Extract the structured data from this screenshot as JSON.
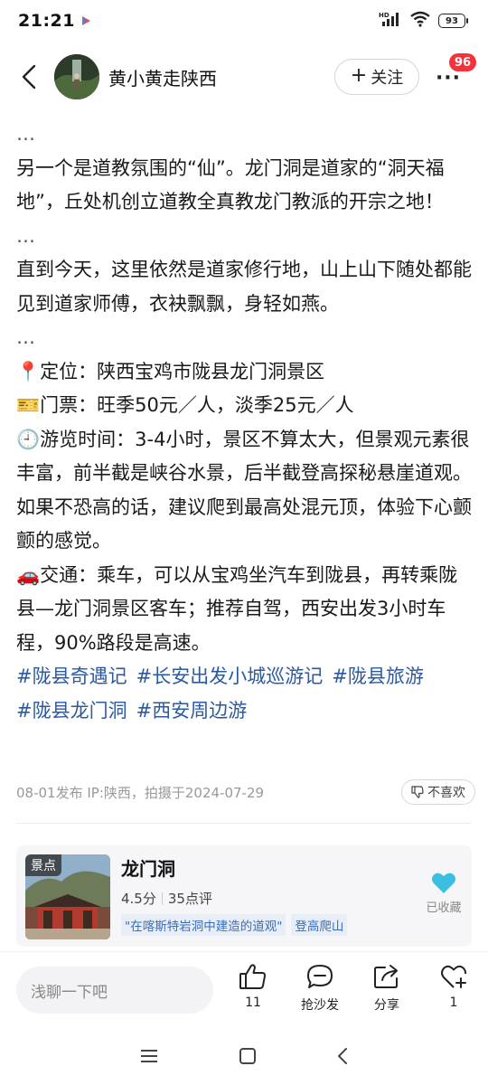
{
  "status_bar": {
    "time": "21:21",
    "battery_level": "93",
    "network_label": "HD"
  },
  "header": {
    "author_name": "黄小黄走陕西",
    "follow_label": "关注",
    "notification_count": "96"
  },
  "content": {
    "ellipsis": "…",
    "paragraph_1": "另一个是道教氛围的“仙”。龙门洞是道家的“洞天福地”，丘处机创立道教全真教龙门教派的开宗之地！",
    "paragraph_2": "直到今天，这里依然是道家修行地，山上山下随处都能见到道家师傅，衣袂飘飘，身轻如燕。",
    "location": "📍定位：陕西宝鸡市陇县龙门洞景区",
    "ticket": "🎫门票：旺季50元／人，淡季25元／人",
    "duration": "🕘游览时间：3-4小时，景区不算太大，但景观元素很丰富，前半截是峡谷水景，后半截登高探秘悬崖道观。如果不恐高的话，建议爬到最高处混元顶，体验下心颤颤的感觉。",
    "transport": "🚗交通：乘车，可以从宝鸡坐汽车到陇县，再转乘陇县—龙门洞景区客车；推荐自驾，西安出发3小时车程，90%路段是高速。",
    "tags": [
      "#陇县奇遇记",
      "#长安出发小城巡游记",
      "#陇县旅游",
      "#陇县龙门洞",
      "#西安周边游"
    ]
  },
  "meta": {
    "publish_info": "08-01发布 IP:陕西，拍摄于2024-07-29",
    "dislike_label": "不喜欢"
  },
  "poi": {
    "label": "景点",
    "title": "龙门洞",
    "score": "4.5分",
    "reviews": "35点评",
    "tags": [
      "\"在喀斯特岩洞中建造的道观\"",
      "登高爬山"
    ],
    "collected_label": "已收藏",
    "heart_color": "#3bbfe0"
  },
  "action_bar": {
    "comment_placeholder": "浅聊一下吧",
    "like_count": "11",
    "comment_label": "抢沙发",
    "share_label": "分享",
    "collect_count": "1"
  },
  "colors": {
    "tag_blue": "#2b5aa0",
    "badge_red": "#f5313a"
  }
}
